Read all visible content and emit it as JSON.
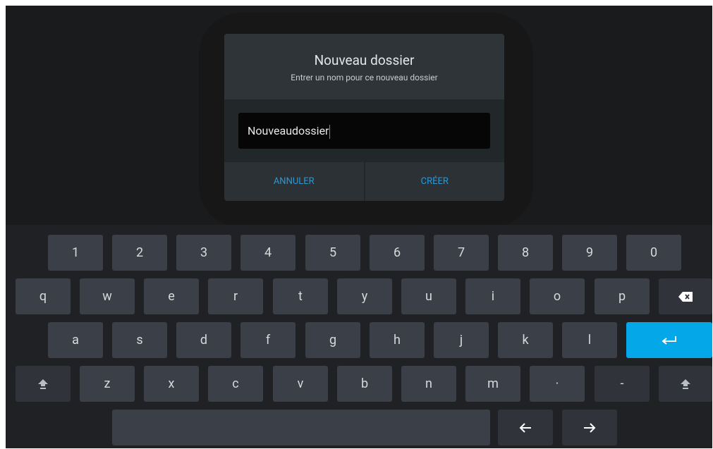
{
  "dialog": {
    "title": "Nouveau dossier",
    "subtitle": "Entrer un nom pour ce nouveau dossier",
    "input_value": "Nouveaudossier",
    "cancel_label": "ANNULER",
    "create_label": "CRÉER",
    "accent_color": "#2b98d5"
  },
  "keyboard": {
    "row1": [
      "1",
      "2",
      "3",
      "4",
      "5",
      "6",
      "7",
      "8",
      "9",
      "0"
    ],
    "row2": [
      "q",
      "w",
      "e",
      "r",
      "t",
      "y",
      "u",
      "i",
      "o",
      "p"
    ],
    "row3": [
      "a",
      "s",
      "d",
      "f",
      "g",
      "h",
      "j",
      "k",
      "l"
    ],
    "row4": [
      "z",
      "x",
      "c",
      "v",
      "b",
      "n",
      "m",
      "·",
      "-"
    ],
    "enter_color": "#04a8e8",
    "icons": {
      "backspace": "backspace-icon",
      "enter": "enter-icon",
      "shift": "shift-icon",
      "left": "arrow-left-icon",
      "right": "arrow-right-icon"
    }
  }
}
